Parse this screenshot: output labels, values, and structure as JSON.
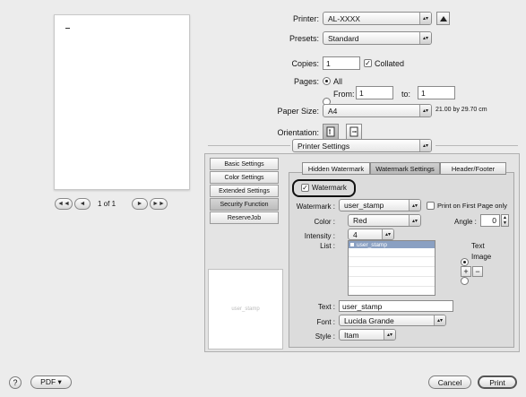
{
  "printer": {
    "label": "Printer:",
    "value": "AL-XXXX"
  },
  "presets": {
    "label": "Presets:",
    "value": "Standard"
  },
  "copies": {
    "label": "Copies:",
    "value": "1",
    "collated_label": "Collated",
    "collated_checked": true
  },
  "pages": {
    "label": "Pages:",
    "all_label": "All",
    "from_label": "From:",
    "from_value": "1",
    "to_label": "to:",
    "to_value": "1"
  },
  "paper_size": {
    "label": "Paper Size:",
    "value": "A4",
    "dims": "21.00 by 29.70 cm"
  },
  "orientation": {
    "label": "Orientation:"
  },
  "section_popup": "Printer Settings",
  "preview_nav": {
    "first": "◄◄",
    "prev": "◄",
    "page_text": "1 of 1",
    "next": "►",
    "last": "►►"
  },
  "sidebar": {
    "items": [
      {
        "label": "Basic Settings"
      },
      {
        "label": "Color Settings"
      },
      {
        "label": "Extended Settings"
      },
      {
        "label": "Security Function"
      },
      {
        "label": "ReserveJob"
      }
    ]
  },
  "tabs": [
    {
      "label": "Hidden Watermark"
    },
    {
      "label": "Watermark Settings"
    },
    {
      "label": "Header/Footer"
    }
  ],
  "watermark": {
    "enable_label": "Watermark",
    "enable_checked": true,
    "watermark_label": "Watermark :",
    "watermark_value": "user_stamp",
    "first_page_label": "Print on First Page only",
    "color_label": "Color :",
    "color_value": "Red",
    "angle_label": "Angle :",
    "angle_value": "0",
    "intensity_label": "Intensity :",
    "intensity_value": "4",
    "list_label": "List :",
    "list_items": [
      "user_stamp"
    ],
    "text_radio": "Text",
    "image_radio": "Image",
    "add": "+",
    "remove": "−",
    "text_label": "Text :",
    "text_value": "user_stamp",
    "font_label": "Font :",
    "font_value": "Lucida Grande",
    "style_label": "Style :",
    "style_value": "Itam"
  },
  "preview_stamp": "user_stamp",
  "bottom": {
    "help": "?",
    "pdf": "PDF ▾",
    "cancel": "Cancel",
    "print": "Print"
  }
}
